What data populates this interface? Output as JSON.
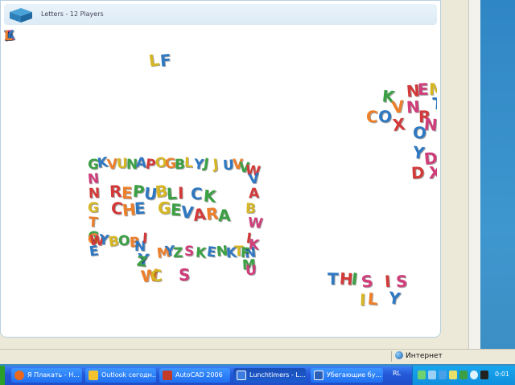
{
  "app": {
    "title": "Letters - 12 Players"
  },
  "status": {
    "zone": "Интернет"
  },
  "taskbar": {
    "items": [
      {
        "label": "Я Плакать - Н...",
        "icon": "firefox-icon",
        "color": "#e8691e"
      },
      {
        "label": "Outlook сегодн...",
        "icon": "outlook-icon",
        "color": "#f2c230"
      },
      {
        "label": "AutoCAD 2006",
        "icon": "autocad-icon",
        "color": "#c23a2a"
      },
      {
        "label": "Lunchtimers - L...",
        "icon": "browser-icon",
        "color": "#3d7de0"
      },
      {
        "label": "Убегающие бу...",
        "icon": "word-icon",
        "color": "#2c5fb8"
      }
    ],
    "lang": "RL",
    "clock": "0:01"
  },
  "colors": {
    "red": "#d23a3a",
    "orange": "#ee7f2a",
    "yellow": "#d6b623",
    "green": "#3aa043",
    "blue": "#2f78c2",
    "pink": "#cf3d7a"
  },
  "magnets": [
    {
      "ch": "L",
      "c": "yellow"
    },
    {
      "ch": "F",
      "c": "blue"
    },
    {
      "ch": "R",
      "c": "red"
    },
    {
      "ch": "E",
      "c": "orange"
    },
    {
      "ch": "P",
      "c": "green"
    },
    {
      "ch": "U",
      "c": "blue"
    },
    {
      "ch": "B",
      "c": "yellow"
    },
    {
      "ch": "L",
      "c": "green"
    },
    {
      "ch": "I",
      "c": "red"
    },
    {
      "ch": "C",
      "c": "blue"
    },
    {
      "ch": "K",
      "c": "green"
    },
    {
      "ch": "C",
      "c": "red"
    },
    {
      "ch": "H",
      "c": "orange"
    },
    {
      "ch": "E",
      "c": "blue"
    },
    {
      "ch": "G",
      "c": "yellow"
    },
    {
      "ch": "E",
      "c": "green"
    },
    {
      "ch": "V",
      "c": "blue"
    },
    {
      "ch": "A",
      "c": "red"
    },
    {
      "ch": "R",
      "c": "orange"
    },
    {
      "ch": "A",
      "c": "green"
    },
    {
      "ch": "T",
      "c": "blue"
    },
    {
      "ch": "H",
      "c": "red"
    },
    {
      "ch": "I",
      "c": "green"
    },
    {
      "ch": "S",
      "c": "pink"
    },
    {
      "ch": "I",
      "c": "red"
    },
    {
      "ch": "S",
      "c": "pink"
    },
    {
      "ch": "I",
      "c": "yellow"
    },
    {
      "ch": "L",
      "c": "orange"
    },
    {
      "ch": "Y",
      "c": "blue"
    },
    {
      "ch": "W",
      "c": "orange"
    },
    {
      "ch": "C",
      "c": "yellow"
    },
    {
      "ch": "S",
      "c": "pink"
    },
    {
      "ch": "Y",
      "c": "blue"
    },
    {
      "ch": "K",
      "c": "green"
    },
    {
      "ch": "V",
      "c": "orange"
    },
    {
      "ch": "N",
      "c": "red"
    },
    {
      "ch": "E",
      "c": "pink"
    },
    {
      "ch": "M",
      "c": "yellow"
    },
    {
      "ch": "C",
      "c": "orange"
    },
    {
      "ch": "O",
      "c": "blue"
    },
    {
      "ch": "X",
      "c": "red"
    },
    {
      "ch": "N",
      "c": "pink"
    },
    {
      "ch": "R",
      "c": "red"
    },
    {
      "ch": "O",
      "c": "blue"
    },
    {
      "ch": "N",
      "c": "pink"
    },
    {
      "ch": "Y",
      "c": "blue"
    },
    {
      "ch": "D",
      "c": "pink"
    },
    {
      "ch": "D",
      "c": "red"
    },
    {
      "ch": "X",
      "c": "pink"
    },
    {
      "ch": "T",
      "c": "blue"
    },
    {
      "ch": "G",
      "c": "green"
    },
    {
      "ch": "K",
      "c": "blue"
    },
    {
      "ch": "V",
      "c": "orange"
    },
    {
      "ch": "U",
      "c": "yellow"
    },
    {
      "ch": "N",
      "c": "green"
    },
    {
      "ch": "A",
      "c": "blue"
    },
    {
      "ch": "P",
      "c": "red"
    },
    {
      "ch": "O",
      "c": "yellow"
    },
    {
      "ch": "G",
      "c": "orange"
    },
    {
      "ch": "B",
      "c": "green"
    },
    {
      "ch": "L",
      "c": "yellow"
    },
    {
      "ch": "Y",
      "c": "blue"
    },
    {
      "ch": "J",
      "c": "green"
    },
    {
      "ch": "J",
      "c": "yellow"
    },
    {
      "ch": "U",
      "c": "blue"
    },
    {
      "ch": "V",
      "c": "orange"
    },
    {
      "ch": "V",
      "c": "green"
    },
    {
      "ch": "W",
      "c": "red"
    },
    {
      "ch": "V",
      "c": "blue"
    },
    {
      "ch": "N",
      "c": "pink"
    },
    {
      "ch": "N",
      "c": "red"
    },
    {
      "ch": "G",
      "c": "yellow"
    },
    {
      "ch": "T",
      "c": "orange"
    },
    {
      "ch": "G",
      "c": "green"
    },
    {
      "ch": "E",
      "c": "blue"
    },
    {
      "ch": "G",
      "c": "orange"
    },
    {
      "ch": "A",
      "c": "red"
    },
    {
      "ch": "B",
      "c": "yellow"
    },
    {
      "ch": "W",
      "c": "pink"
    },
    {
      "ch": "I",
      "c": "red"
    },
    {
      "ch": "N",
      "c": "blue"
    },
    {
      "ch": "M",
      "c": "green"
    },
    {
      "ch": "U",
      "c": "pink"
    },
    {
      "ch": "W",
      "c": "red"
    },
    {
      "ch": "Y",
      "c": "blue"
    },
    {
      "ch": "B",
      "c": "yellow"
    },
    {
      "ch": "O",
      "c": "green"
    },
    {
      "ch": "B",
      "c": "orange"
    },
    {
      "ch": "N",
      "c": "blue"
    },
    {
      "ch": "I",
      "c": "red"
    },
    {
      "ch": "Z",
      "c": "green"
    },
    {
      "ch": "M",
      "c": "orange"
    },
    {
      "ch": "Y",
      "c": "blue"
    },
    {
      "ch": "Z",
      "c": "green"
    },
    {
      "ch": "S",
      "c": "pink"
    },
    {
      "ch": "K",
      "c": "green"
    },
    {
      "ch": "E",
      "c": "blue"
    },
    {
      "ch": "N",
      "c": "green"
    },
    {
      "ch": "K",
      "c": "blue"
    },
    {
      "ch": "T",
      "c": "yellow"
    },
    {
      "ch": "F",
      "c": "green"
    },
    {
      "ch": "K",
      "c": "pink"
    },
    {
      "ch": "A",
      "c": "blue"
    },
    {
      "ch": "Z",
      "c": "pink"
    },
    {
      "ch": "Y",
      "c": "blue"
    },
    {
      "ch": "L",
      "c": "orange"
    }
  ]
}
